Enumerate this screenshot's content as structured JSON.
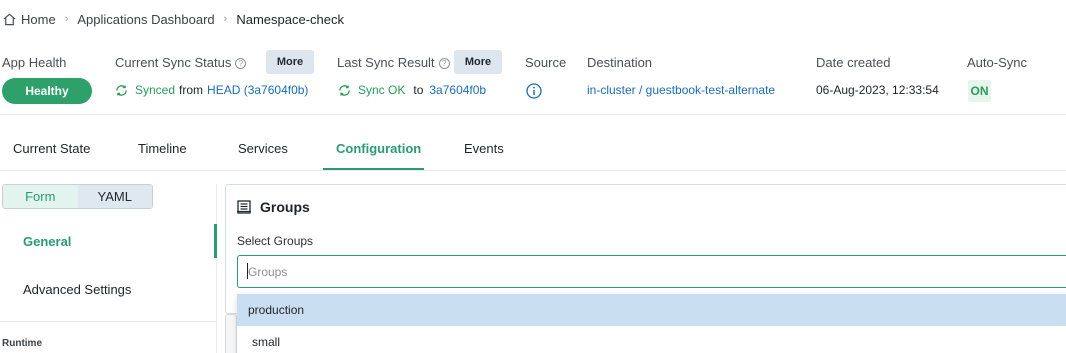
{
  "breadcrumb": {
    "home": "Home",
    "dashboard": "Applications Dashboard",
    "current": "Namespace-check"
  },
  "status": {
    "app_health_label": "App Health",
    "health_value": "Healthy",
    "current_sync_label": "Current Sync Status",
    "more_label": "More",
    "synced_text": "Synced",
    "from_text": "from",
    "head_ref": "HEAD (3a7604f0b)",
    "last_sync_label": "Last Sync Result",
    "sync_ok_text": "Sync OK",
    "to_text": "to",
    "last_sync_ref": "3a7604f0b",
    "source_label": "Source",
    "destination_label": "Destination",
    "destination_value": "in-cluster / guestbook-test-alternate",
    "date_label": "Date created",
    "date_value": "06-Aug-2023, 12:33:54",
    "autosync_label": "Auto-Sync",
    "autosync_value": "ON"
  },
  "tabs": [
    "Current State",
    "Timeline",
    "Services",
    "Configuration",
    "Events"
  ],
  "active_tab": "Configuration",
  "sidebar": {
    "form_label": "Form",
    "yaml_label": "YAML",
    "items": [
      "General",
      "Advanced Settings"
    ],
    "section": "Runtime"
  },
  "groups": {
    "title": "Groups",
    "select_label": "Select Groups",
    "placeholder": "Groups",
    "options": [
      "production",
      "small"
    ]
  },
  "colors": {
    "accent": "#2a9a77",
    "healthy": "#2ea06a",
    "link": "#1a6db3",
    "highlight": "#c9dff1"
  }
}
